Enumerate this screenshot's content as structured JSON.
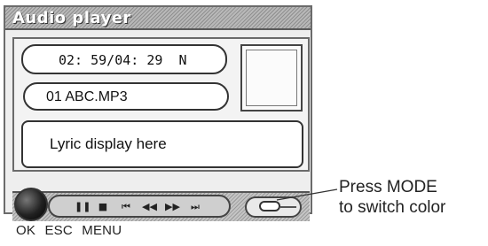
{
  "window": {
    "title": "Audio player"
  },
  "display": {
    "time": "02: 59/04: 29  N",
    "filename": "01 ABC.MP3",
    "lyric": "Lyric display here"
  },
  "controls": {
    "transport_icons": [
      "pause-icon",
      "stop-icon",
      "skip-back-icon",
      "rewind-icon",
      "fast-forward-icon",
      "skip-forward-icon"
    ],
    "transport_glyphs": [
      "❚❚",
      "■",
      "⏮",
      "◀◀",
      "▶▶",
      "⏭"
    ]
  },
  "buttons": {
    "ok": "OK",
    "esc": "ESC",
    "menu": "MENU"
  },
  "callout": {
    "line1": "Press MODE",
    "line2": "to switch color"
  }
}
